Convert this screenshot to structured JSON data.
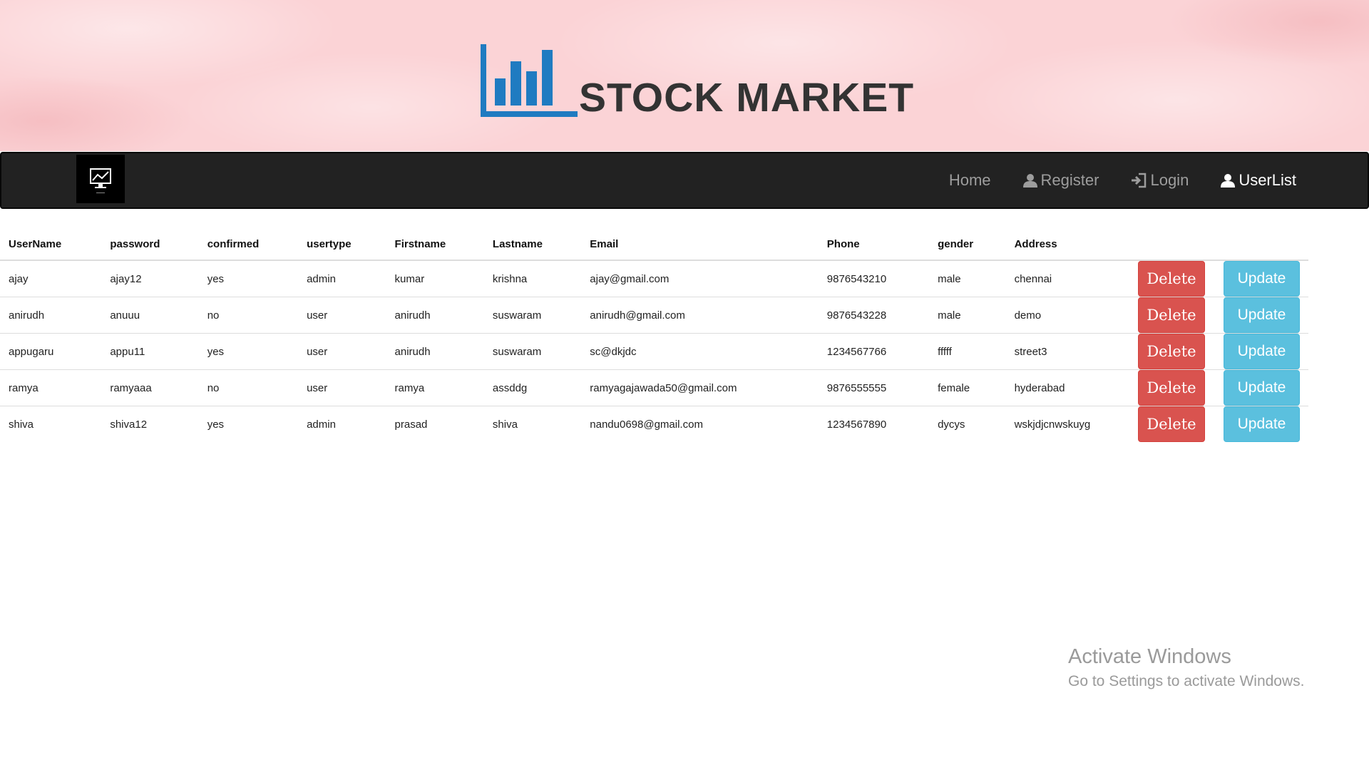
{
  "header": {
    "brand": "STOCK MARKET"
  },
  "nav": {
    "links": [
      {
        "label": "Home",
        "icon": "none"
      },
      {
        "label": "Register",
        "icon": "user-icon"
      },
      {
        "label": "Login",
        "icon": "login-icon"
      },
      {
        "label": "UserList",
        "icon": "user-icon"
      }
    ]
  },
  "table": {
    "headers": [
      "UserName",
      "password",
      "confirmed",
      "usertype",
      "Firstname",
      "Lastname",
      "Email",
      "Phone",
      "gender",
      "Address"
    ],
    "rows": [
      [
        "ajay",
        "ajay12",
        "yes",
        "admin",
        "kumar",
        "krishna",
        "ajay@gmail.com",
        "9876543210",
        "male",
        "chennai"
      ],
      [
        "anirudh",
        "anuuu",
        "no",
        "user",
        "anirudh",
        "suswaram",
        "anirudh@gmail.com",
        "9876543228",
        "male",
        "demo"
      ],
      [
        "appugaru",
        "appu11",
        "yes",
        "user",
        "anirudh",
        "suswaram",
        "sc@dkjdc",
        "1234567766",
        "fffff",
        "street3"
      ],
      [
        "ramya",
        "ramyaaa",
        "no",
        "user",
        "ramya",
        "assddg",
        "ramyagajawada50@gmail.com",
        "9876555555",
        "female",
        "hyderabad"
      ],
      [
        "shiva",
        "shiva12",
        "yes",
        "admin",
        "prasad",
        "shiva",
        "nandu0698@gmail.com",
        "1234567890",
        "dycys",
        "wskjdjcnwskuyg"
      ]
    ],
    "delete_label": "Delete",
    "update_label": "Update"
  },
  "watermark": {
    "title": "Activate Windows",
    "subtitle": "Go to Settings to activate Windows."
  },
  "colors": {
    "banner": "#fbd3d6",
    "navbar": "#222222",
    "logo_blue": "#1f7bc1",
    "delete": "#d9534f",
    "update": "#5bc0de"
  }
}
